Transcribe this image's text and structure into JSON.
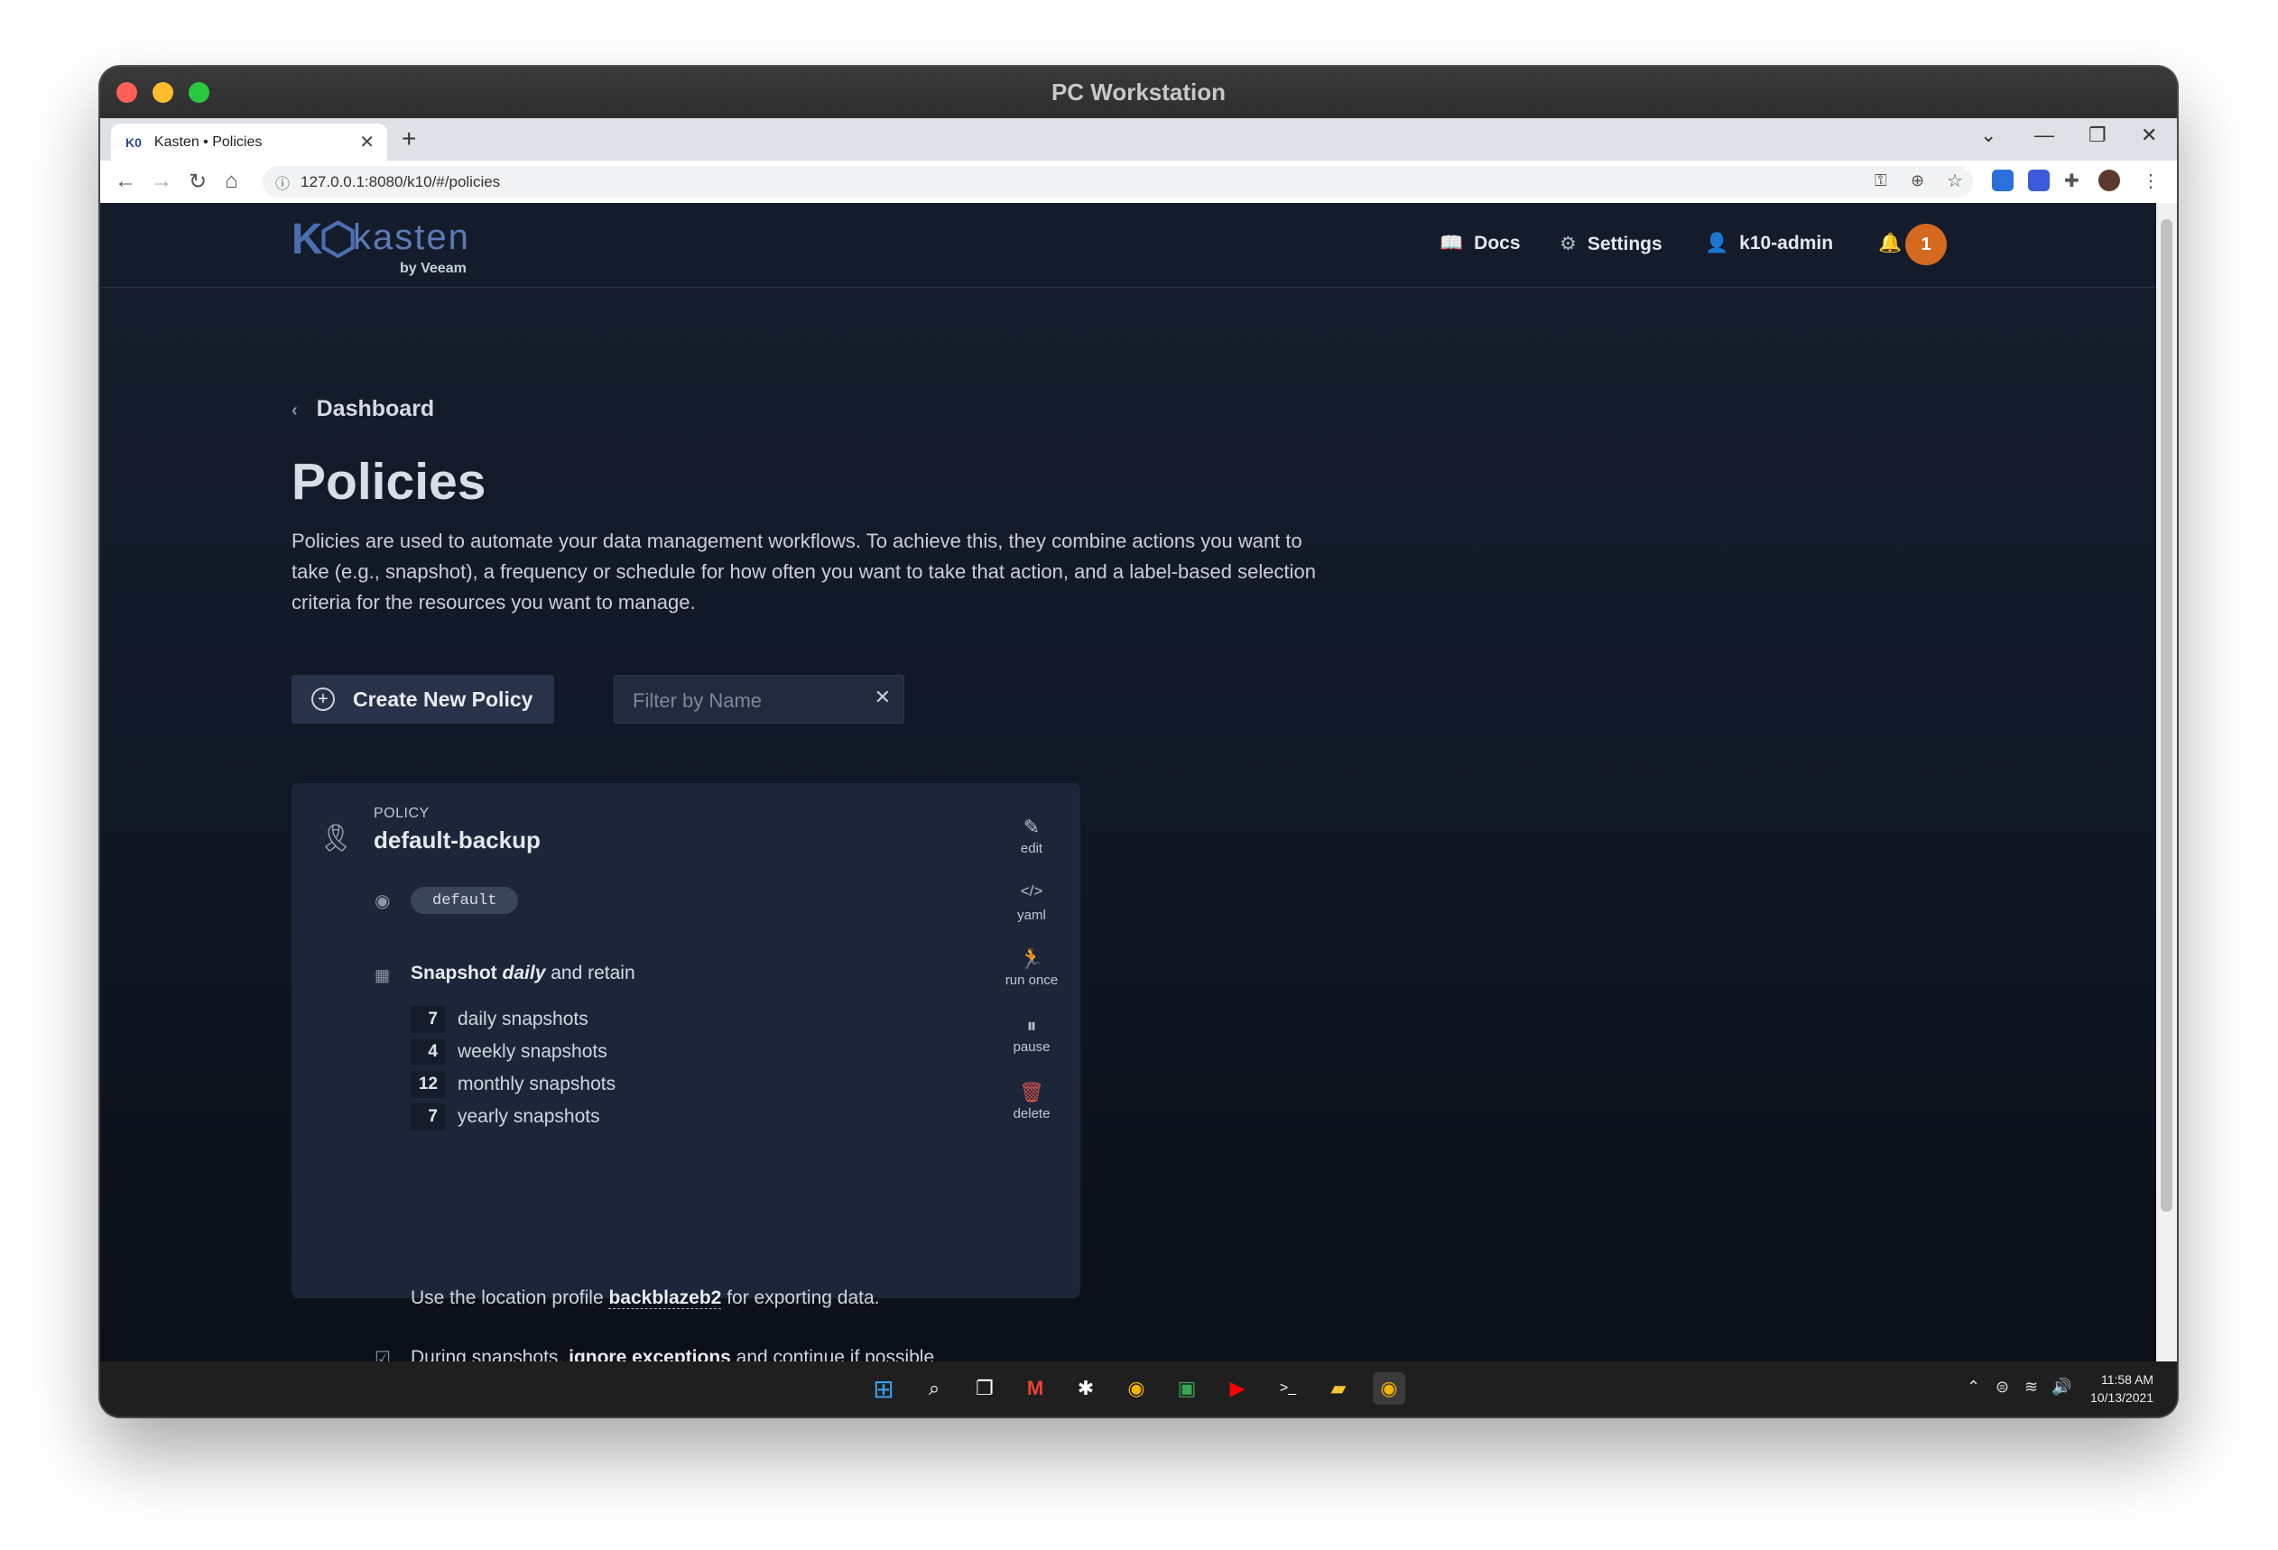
{
  "window": {
    "title": "PC Workstation"
  },
  "browser": {
    "tab_title": "Kasten • Policies",
    "url": "127.0.0.1:8080/k10/#/policies"
  },
  "header": {
    "logo_text": "kasten",
    "logo_sub": "by Veeam",
    "docs_label": "Docs",
    "settings_label": "Settings",
    "user_label": "k10-admin",
    "notification_count": "1"
  },
  "page": {
    "breadcrumb": "Dashboard",
    "title": "Policies",
    "description": "Policies are used to automate your data management workflows. To achieve this, they combine actions you want to take (e.g., snapshot), a frequency or schedule for how often you want to take that action, and a label-based selection criteria for the resources you want to manage.",
    "create_button": "Create New Policy",
    "filter_placeholder": "Filter by Name"
  },
  "policy": {
    "kicker": "POLICY",
    "name": "default-backup",
    "namespace": "default",
    "snapshot_prefix": "Snapshot",
    "frequency": "daily",
    "snapshot_suffix": "and retain",
    "retention": [
      {
        "count": "7",
        "label": "daily snapshots"
      },
      {
        "count": "4",
        "label": "weekly snapshots"
      },
      {
        "count": "12",
        "label": "monthly snapshots"
      },
      {
        "count": "7",
        "label": "yearly snapshots"
      }
    ],
    "location_prefix": "Use the location profile",
    "location_profile": "backblazeb2",
    "location_suffix": "for exporting data.",
    "during_prefix": "During snapshots,",
    "during_bold": "ignore exceptions",
    "during_suffix": "and continue if possible",
    "actions": {
      "edit": "edit",
      "yaml": "yaml",
      "run_once": "run once",
      "pause": "pause",
      "delete": "delete"
    }
  },
  "taskbar": {
    "time": "11:58 AM",
    "date": "10/13/2021"
  },
  "colors": {
    "accent_orange": "#d46a1f",
    "card_bg": "#1c2638",
    "page_bg": "#111827",
    "delete_red": "#d9534f"
  }
}
